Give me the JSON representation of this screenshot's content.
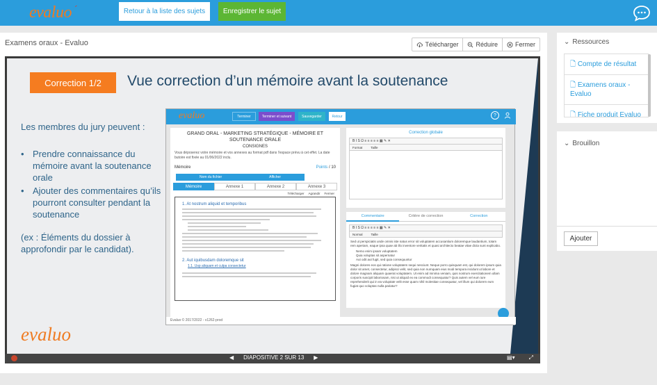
{
  "header": {
    "logo": "evaluo",
    "back_label": "Retour à la liste des sujets",
    "save_label": "Enregistrer le sujet"
  },
  "panel": {
    "title": "Examens oraux - Evaluo",
    "download_label": "Télécharger",
    "reduce_label": "Réduire",
    "close_label": "Fermer"
  },
  "slide": {
    "badge": "Correction 1/2",
    "title": "Vue correction d’un mémoire avant la soutenance",
    "intro": "Les membres du jury peuvent :",
    "bullets": [
      "Prendre connaissance du mémoire avant la soutenance orale",
      "Ajouter des commentaires qu’ils pourront consulter pendant la soutenance"
    ],
    "example": "(ex : Éléments du dossier à approfondir par le candidat).",
    "logo": "evaluo"
  },
  "embed": {
    "logo": "evaluo",
    "buttons": [
      "Terminer",
      "Terminer et suivant",
      "Sauvegarder",
      "Retour"
    ],
    "heading": "GRAND ORAL - MARKETING STRATÉGIQUE - MÉMOIRE ET SOUTENANCE ORALE",
    "consignes": "CONSIGNES",
    "instructions": "Vous déposerez votre mémoire et vos annexes au format pdf dans l'espace prévu à cet effet. La date butoire est fixée au 01/06/2022 inclu.",
    "memoire_label": "Mémoire",
    "points_label": "Points",
    "points_max": "/ 10",
    "file_header": "Nom du fichier",
    "file_action": "Afficher",
    "tabs": [
      "Mémoire",
      "Annexe 1",
      "Annexe 2",
      "Annexe 3"
    ],
    "doc_actions": [
      "Télécharger",
      "Agrandir",
      "Fermer"
    ],
    "section1": "1.   At nostrum aliquid et temporibus",
    "section2": "2.   Aut iquibusdam doloremque sit",
    "sublink": "1.1. Usp aliquam et culpa consectetur",
    "right_heading": "Correction globale",
    "toolbar": "B  I  S  Ω  ≡  ≡  ≡  ≡  ≡  ▦  ✎  ✕",
    "toolbar_format": "Format",
    "toolbar_size": "Taille",
    "toolbar_normal": "Normal",
    "tabs_right": [
      "Commentaire",
      "Critère de correction",
      "Correction"
    ],
    "comment_text": "Sed ut perspiciatis unde omnis iste natus error sit voluptatem accusantium doloremque laudantium, totam rem aperiam, eaque ipsa quae ab illo inventore veritatis et quasi architecto beatae vitae dicta sunt explicabo.",
    "comment_bullets": [
      "Nemo enim ipsam voluptatem",
      "Quia voluptas sit aspernatur",
      "Aut odit aut fugit, sed quia consequuntur"
    ],
    "comment_text2": "Magni dolores eos qui ratione voluptatem sequi nesciunt. Neque porro quisquam est, qui dolorem ipsum quia dolor sit amet, consectetur, adipisci velit, sed quia non numquam eius modi tempora incidunt ut labore et dolore magnam aliquam quaerat voluptatem. Ut enim ad minima veniam, quis nostrum exercitationem ullam corporis suscipit laboriosam, nisi ut aliquid ex ea commodi consequatur? Quis autem vel eum iure reprehenderit qui in ea voluptate velit esse quam nihil molestiae consequatur, vel illum qui dolorem eum fugiat quo voluptas nulla pariatur?",
    "footer": "Evaluo © 2017/2022 - v1262-prod"
  },
  "viewer": {
    "slide_counter": "DIAPOSITIVE 2 SUR 13"
  },
  "resources": {
    "title": "Ressources",
    "items": [
      "Compte de résultat",
      "Examens oraux - Evaluo",
      "Fiche produit Evaluo"
    ]
  },
  "draft": {
    "title": "Brouillon",
    "add_label": "Ajouter"
  },
  "colors": {
    "brand_blue": "#2b9ddc",
    "save_green": "#5cb634",
    "orange": "#f57c20",
    "navy": "#1d3a54"
  }
}
